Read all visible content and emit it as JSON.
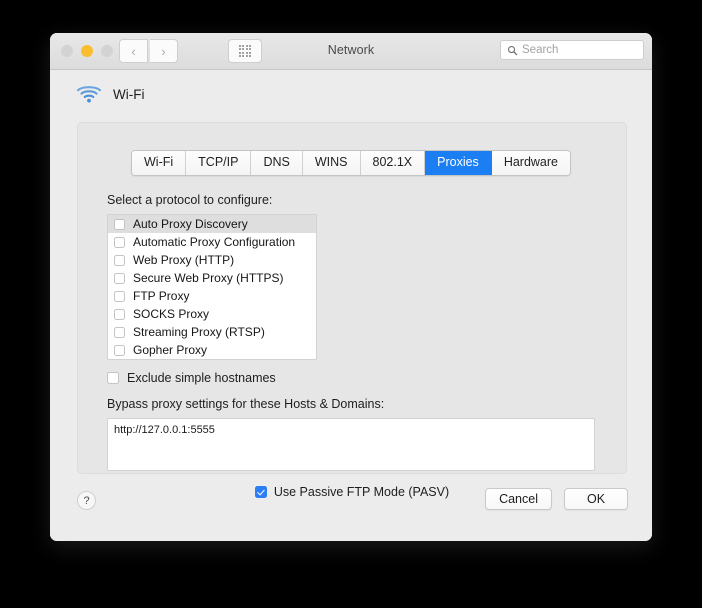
{
  "window": {
    "title": "Network",
    "traffic_lights": [
      "close",
      "minimize",
      "zoom"
    ],
    "nav": {
      "back_icon": "chevron-left-icon",
      "forward_icon": "chevron-right-icon",
      "grid_icon": "show-all-grid-icon"
    },
    "search": {
      "placeholder": "Search",
      "value": "",
      "icon": "search-icon"
    }
  },
  "interface": {
    "icon": "wifi-icon",
    "name": "Wi-Fi"
  },
  "tabs": [
    {
      "label": "Wi-Fi",
      "active": false
    },
    {
      "label": "TCP/IP",
      "active": false
    },
    {
      "label": "DNS",
      "active": false
    },
    {
      "label": "WINS",
      "active": false
    },
    {
      "label": "802.1X",
      "active": false
    },
    {
      "label": "Proxies",
      "active": true
    },
    {
      "label": "Hardware",
      "active": false
    }
  ],
  "proxies": {
    "select_label": "Select a protocol to configure:",
    "protocols": [
      {
        "label": "Auto Proxy Discovery",
        "checked": false,
        "selected": true
      },
      {
        "label": "Automatic Proxy Configuration",
        "checked": false,
        "selected": false
      },
      {
        "label": "Web Proxy (HTTP)",
        "checked": false,
        "selected": false
      },
      {
        "label": "Secure Web Proxy (HTTPS)",
        "checked": false,
        "selected": false
      },
      {
        "label": "FTP Proxy",
        "checked": false,
        "selected": false
      },
      {
        "label": "SOCKS Proxy",
        "checked": false,
        "selected": false
      },
      {
        "label": "Streaming Proxy (RTSP)",
        "checked": false,
        "selected": false
      },
      {
        "label": "Gopher Proxy",
        "checked": false,
        "selected": false
      }
    ],
    "exclude_simple_hostnames": {
      "label": "Exclude simple hostnames",
      "checked": false
    },
    "bypass_label": "Bypass proxy settings for these Hosts & Domains:",
    "bypass_value": "http://127.0.0.1:5555",
    "passive_ftp": {
      "label": "Use Passive FTP Mode (PASV)",
      "checked": true
    }
  },
  "footer": {
    "help_label": "?",
    "cancel_label": "Cancel",
    "ok_label": "OK"
  },
  "colors": {
    "accent_blue": "#1c7ef3",
    "checkbox_blue": "#2b7ef5",
    "wifi_blue": "#4a90d9",
    "amber_light": "#f9bd2e",
    "window_bg": "#ececec",
    "panel_bg": "#e6e6e6",
    "selection_gray": "#dedede",
    "desktop_bg": "#000000"
  }
}
